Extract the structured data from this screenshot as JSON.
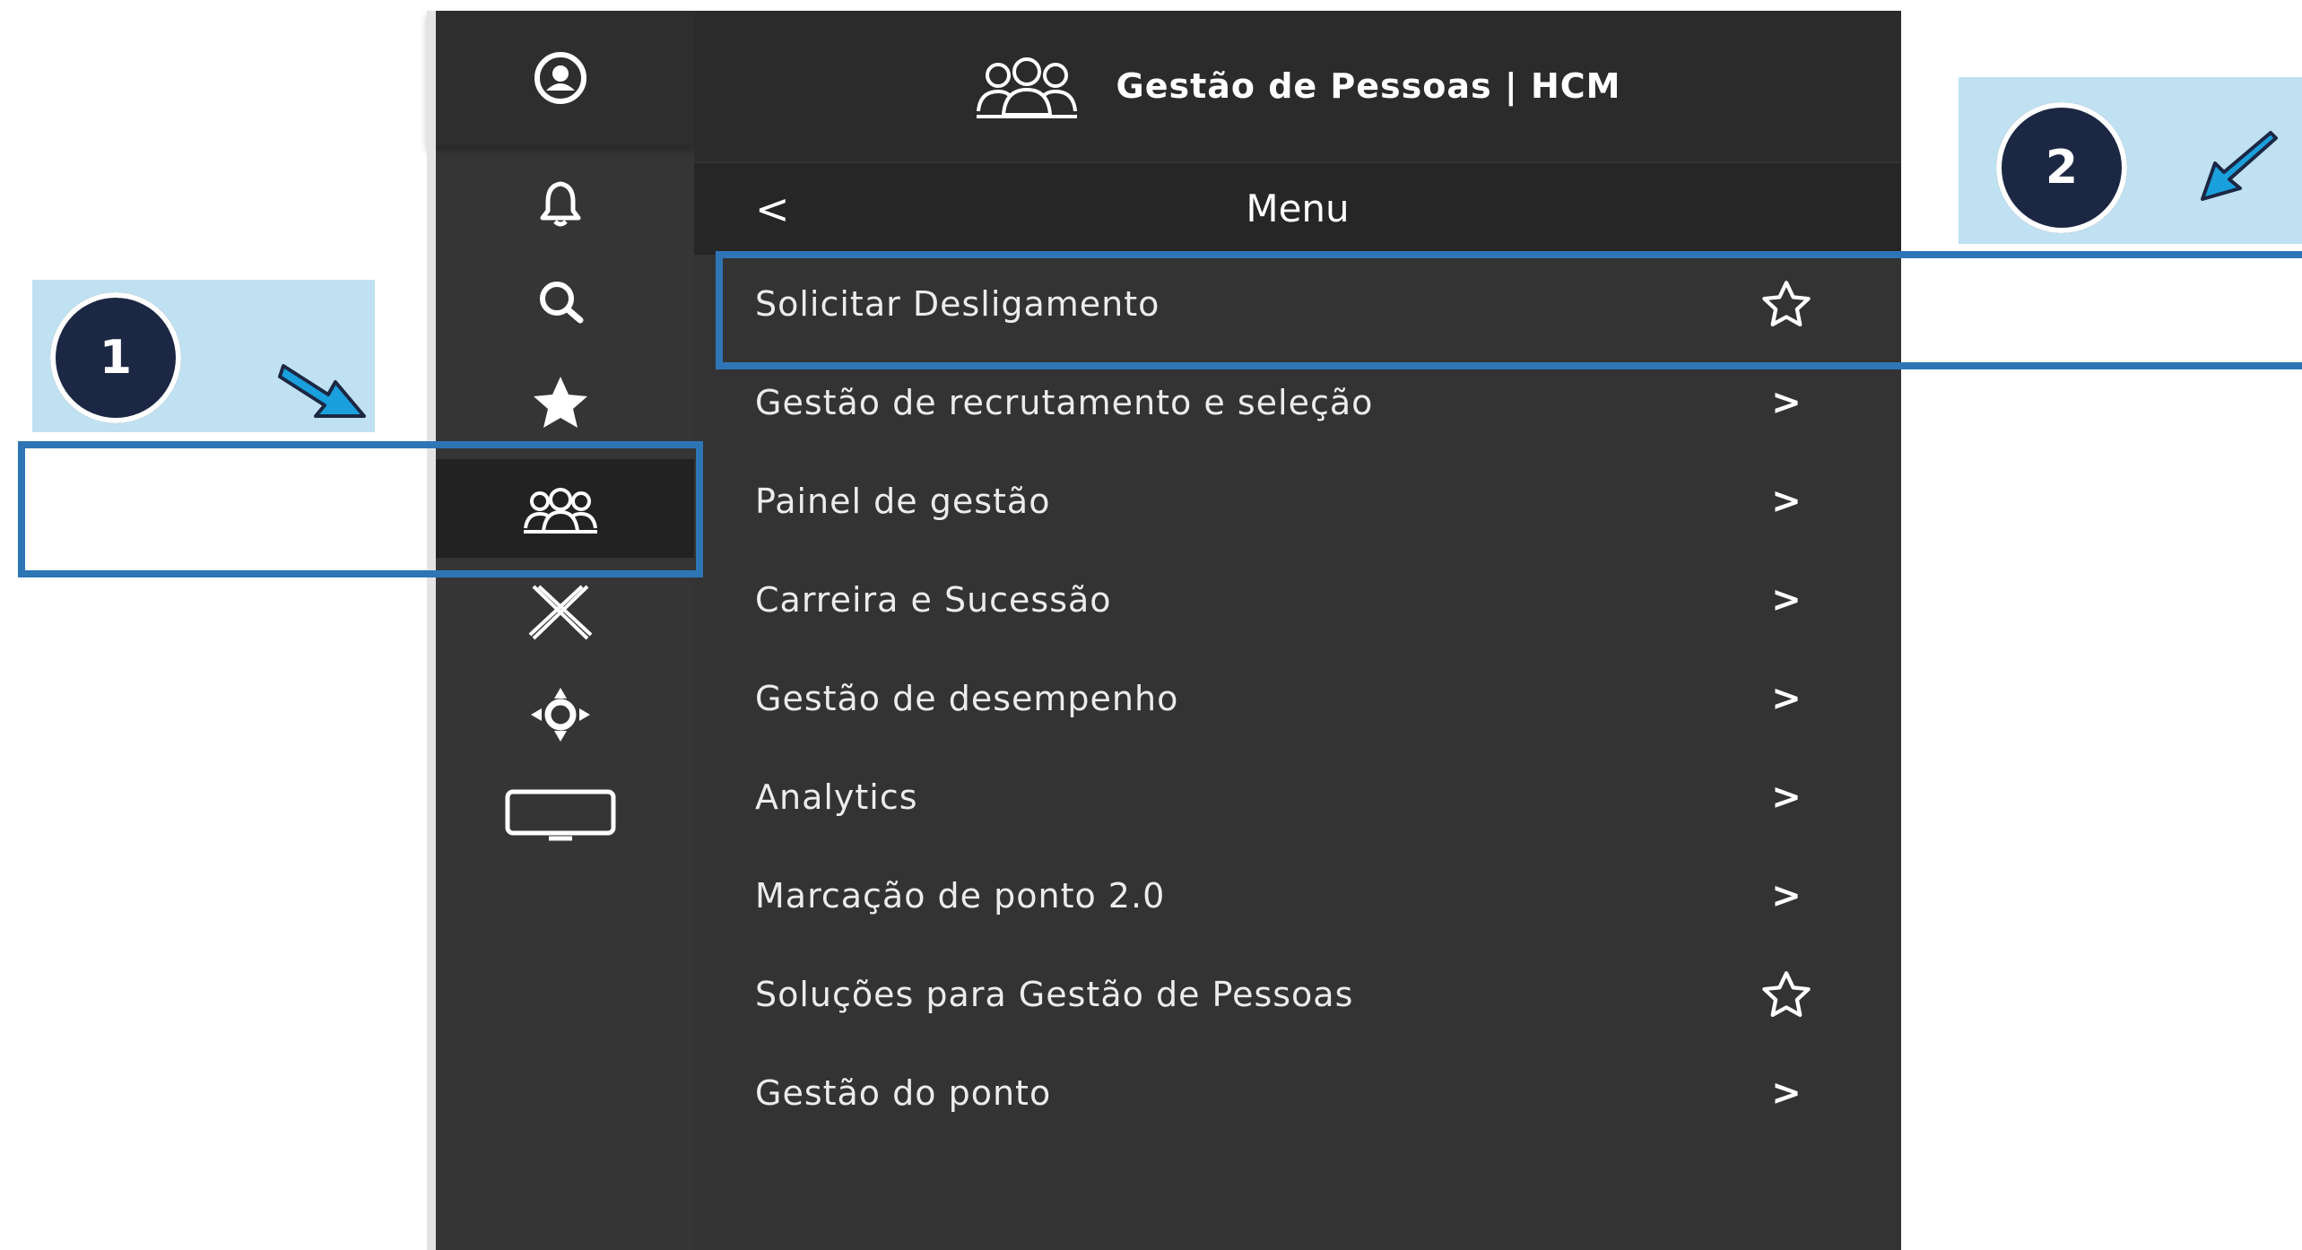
{
  "app": {
    "title": "Gestão de Pessoas | HCM"
  },
  "rail": {
    "icons": [
      "user-avatar-icon",
      "bell-icon",
      "search-icon",
      "star-icon",
      "people-group-icon",
      "x-tools-icon",
      "move-arrows-icon",
      "monitor-icon"
    ],
    "active_icon": "people-group-icon"
  },
  "menu": {
    "back_label": "<",
    "title": "Menu",
    "items": [
      {
        "label": "Solicitar Desligamento",
        "action": "star"
      },
      {
        "label": "Gestão de recrutamento e seleção",
        "action": ">"
      },
      {
        "label": "Painel de gestão",
        "action": ">"
      },
      {
        "label": "Carreira e Sucessão",
        "action": ">"
      },
      {
        "label": "Gestão de desempenho",
        "action": ">"
      },
      {
        "label": "Analytics",
        "action": ">"
      },
      {
        "label": "Marcação de ponto 2.0",
        "action": ">"
      },
      {
        "label": "Soluções para Gestão de Pessoas",
        "action": "star"
      },
      {
        "label": "Gestão do ponto",
        "action": ">"
      }
    ]
  },
  "callouts": [
    {
      "number": "1"
    },
    {
      "number": "2"
    }
  ],
  "colors": {
    "rail": "#353535",
    "panel": "#333333",
    "header": "#2b2b2b",
    "callout_bg": "#bfe1f1",
    "badge": "#1c2744",
    "highlight": "#2e75b6",
    "arrow": "#1aa0dc"
  }
}
